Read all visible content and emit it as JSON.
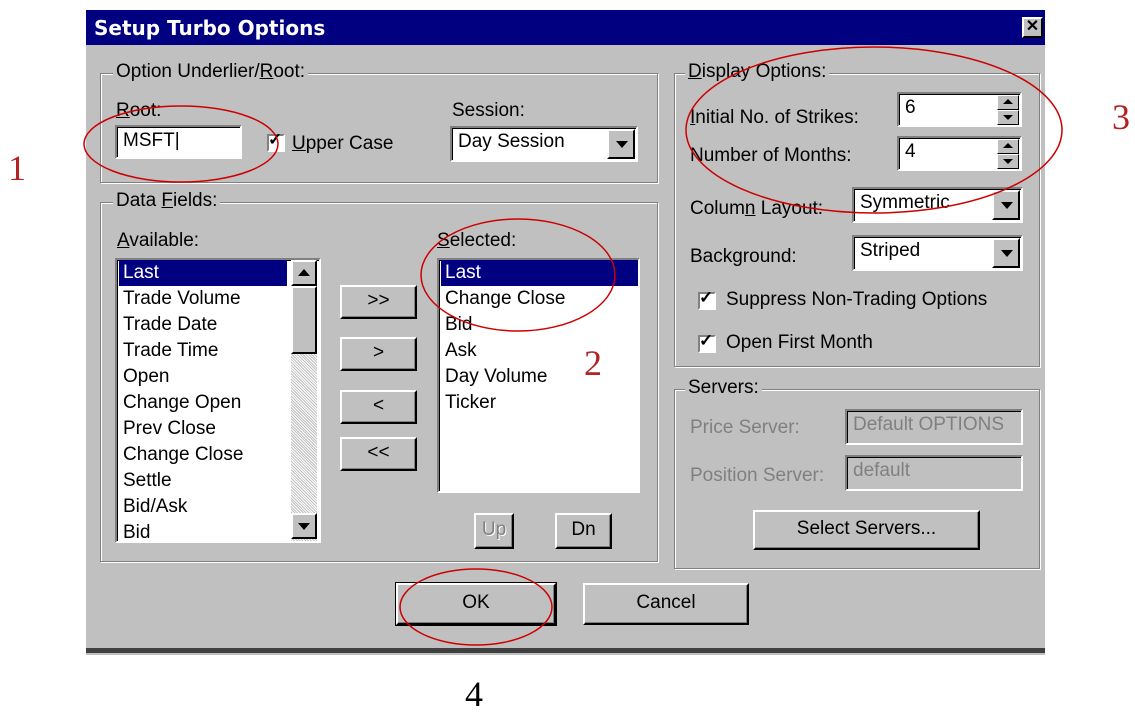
{
  "window": {
    "title": "Setup Turbo Options",
    "close_glyph": "✕"
  },
  "underlier": {
    "group_title": "Option Underlier/Root:",
    "root_label": "Root:",
    "root_value": "MSFT",
    "upper_case_label": "Upper Case",
    "upper_case_checked": true,
    "session_label": "Session:",
    "session_value": "Day Session"
  },
  "data_fields": {
    "group_title": "Data Fields:",
    "available_label": "Available:",
    "selected_label": "Selected:",
    "available_items": [
      "Last",
      "Trade Volume",
      "Trade Date",
      "Trade Time",
      "Open",
      "Change Open",
      "Prev Close",
      "Change Close",
      "Settle",
      "Bid/Ask",
      "Bid"
    ],
    "available_selected_index": 0,
    "selected_items": [
      "Last",
      "Change Close",
      "Bid",
      "Ask",
      "Day Volume",
      "Ticker"
    ],
    "selected_selected_index": 0,
    "move_buttons": {
      "add_all": ">>",
      "add": ">",
      "remove": "<",
      "remove_all": "<<"
    },
    "up_label": "Up",
    "dn_label": "Dn"
  },
  "display": {
    "group_title": "Display Options:",
    "strikes_label": "Initial No. of Strikes:",
    "strikes_value": "6",
    "months_label": "Number of Months:",
    "months_value": "4",
    "column_layout_label": "Column Layout:",
    "column_layout_value": "Symmetric",
    "background_label": "Background:",
    "background_value": "Striped",
    "suppress_label": "Suppress Non-Trading Options",
    "suppress_checked": true,
    "open_first_label": "Open First Month",
    "open_first_checked": true
  },
  "servers": {
    "group_title": "Servers:",
    "price_label": "Price Server:",
    "price_value": "Default OPTIONS",
    "position_label": "Position Server:",
    "position_value": "default",
    "select_button": "Select Servers..."
  },
  "footer": {
    "ok_label": "OK",
    "cancel_label": "Cancel"
  },
  "annotations": {
    "n1": "1",
    "n2": "2",
    "n3": "3",
    "n4": "4"
  },
  "colors": {
    "titlebar": "#000080",
    "dialog": "#c0c0c0",
    "selection": "#000080",
    "annotation": "#cc0000"
  }
}
